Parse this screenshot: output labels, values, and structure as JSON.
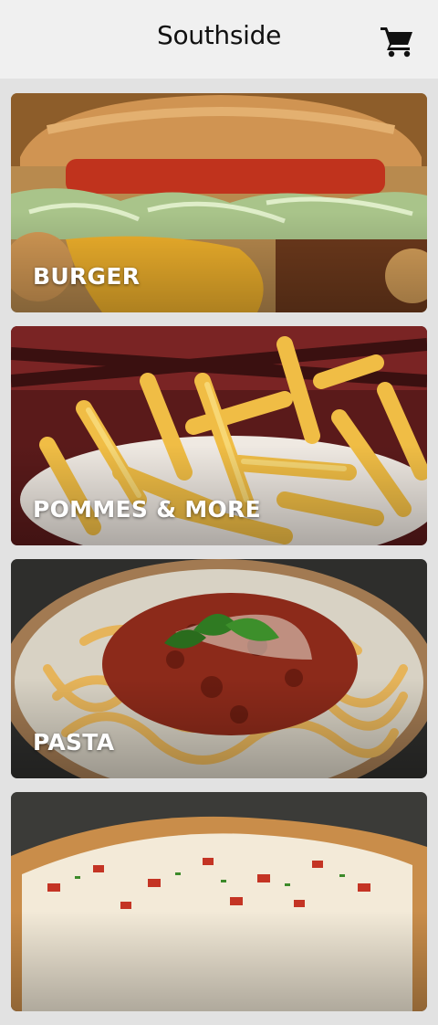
{
  "header": {
    "title": "Southside",
    "cart_icon": "shopping-cart-icon"
  },
  "categories": [
    {
      "label": "BURGER"
    },
    {
      "label": "POMMES & MORE"
    },
    {
      "label": "PASTA"
    },
    {
      "label": ""
    }
  ]
}
